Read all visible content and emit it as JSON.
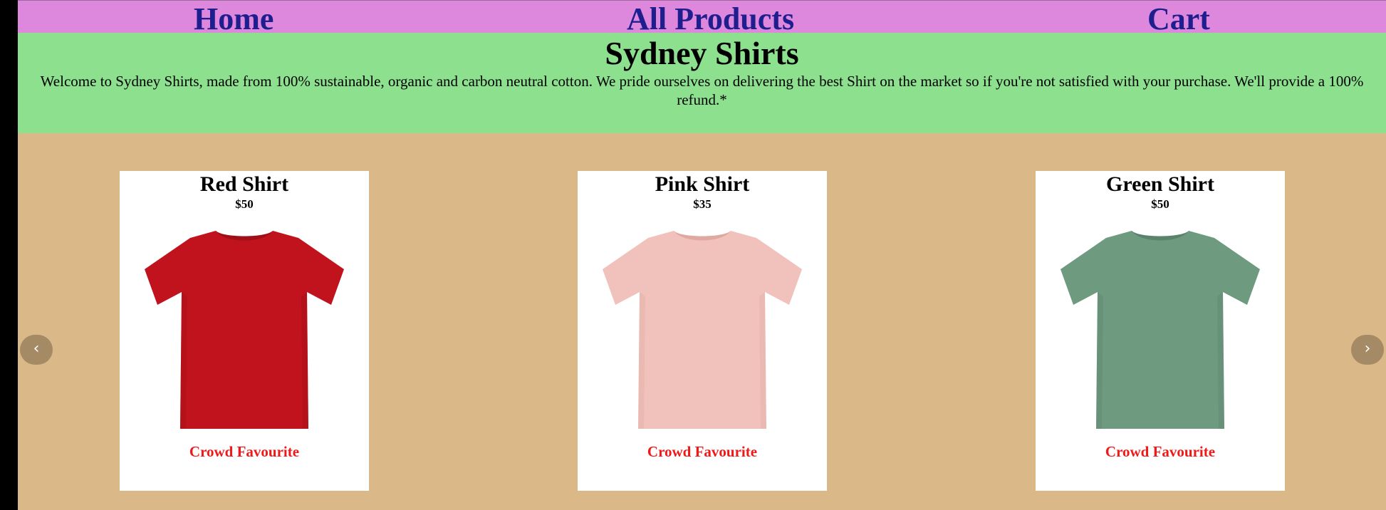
{
  "nav": {
    "home": "Home",
    "all_products": "All Products",
    "cart": "Cart"
  },
  "banner": {
    "title": "Sydney Shirts",
    "text": "Welcome to Sydney Shirts, made from 100% sustainable, organic and carbon neutral cotton. We pride ourselves on delivering the best Shirt on the market so if you're not satisfied with your purchase. We'll provide a 100% refund.*"
  },
  "carousel": {
    "prev_glyph": "‹",
    "next_glyph": "›",
    "products": [
      {
        "name": "Red Shirt",
        "price": "$50",
        "badge": "Crowd Favourite",
        "color": "#c0131e",
        "shade": "#9e0f18"
      },
      {
        "name": "Pink Shirt",
        "price": "$35",
        "badge": "Crowd Favourite",
        "color": "#f0c2bb",
        "shade": "#dfa9a2"
      },
      {
        "name": "Green Shirt",
        "price": "$50",
        "badge": "Crowd Favourite",
        "color": "#6e9a80",
        "shade": "#5b836c"
      }
    ]
  },
  "colors": {
    "nav_bg": "#dd88dd",
    "nav_text": "#1e1e8e",
    "banner_bg": "#8ce08e",
    "page_bg": "#dbb888",
    "badge_text": "#f01818"
  },
  "icons": {
    "prev": "chevron-left-icon",
    "next": "chevron-right-icon"
  }
}
